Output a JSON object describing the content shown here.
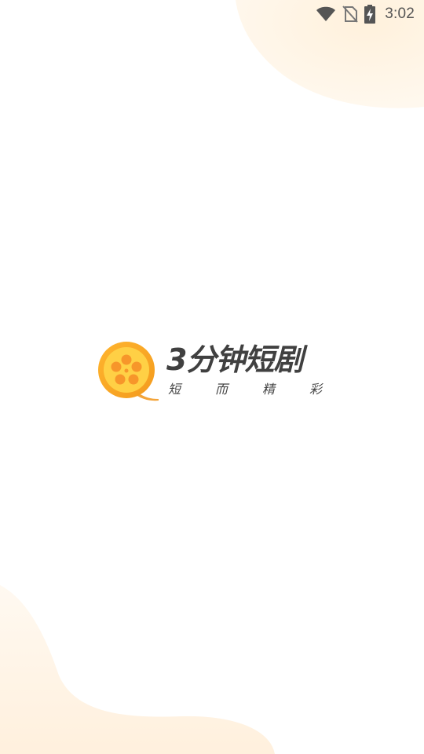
{
  "status_bar": {
    "time": "3:02",
    "icons": [
      "wifi-icon",
      "no-sim-icon",
      "battery-charging-icon"
    ]
  },
  "splash": {
    "logo_icon": "film-reel-q-icon",
    "title": "3分钟短剧",
    "slogan": [
      "短",
      "而",
      "精",
      "彩"
    ]
  },
  "colors": {
    "accent_orange": "#F5A623",
    "accent_yellow": "#FFC640",
    "background_blob": "#FFF3E2",
    "text_dark": "#404040"
  }
}
